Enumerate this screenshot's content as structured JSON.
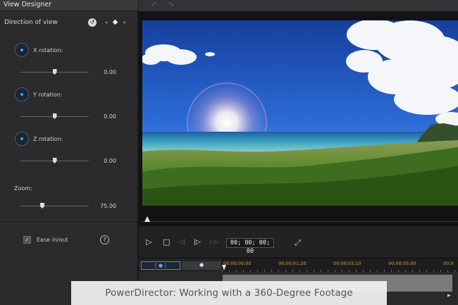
{
  "panel": {
    "title": "View Designer",
    "direction_label": "Direction of view",
    "keyframe_prev": "◂",
    "keyframe_add": "◆",
    "keyframe_next": "▸",
    "keyframe_reset": "↺",
    "x_rotation": {
      "label": "X rotation:",
      "value": "0.00",
      "level": 0.5
    },
    "y_rotation": {
      "label": "Y rotation:",
      "value": "0.00",
      "level": 0.5
    },
    "z_rotation": {
      "label": "Z rotation:",
      "value": "0.00",
      "level": 0.5
    },
    "zoom": {
      "label": "Zoom:",
      "value": "75.00",
      "level": 0.32
    },
    "ease_label": "Ease in/out",
    "ease_checked": "✓",
    "help": "?"
  },
  "toolbar": {
    "undo": "↶",
    "redo": "↷"
  },
  "playback": {
    "play": "▷",
    "stop": "□",
    "prev_frame": "◁|",
    "next_frame": "|▷",
    "fast_forward": "▷▷",
    "timecode": "00; 00; 00; 00",
    "fit": "⤢",
    "expand": "▼"
  },
  "timeline": {
    "tab_a": "[ ● ]",
    "tab_b": "●",
    "ruler_labels": [
      "00;00;00;00",
      "00;00;01;20",
      "00;00;03;10",
      "00;00;05;00",
      "00;0"
    ],
    "track_arrow": "▶"
  },
  "caption": "PowerDirector: Working with a 360-Degree Footage",
  "colors": {
    "accent": "#1c4e82",
    "ruler_text": "#cfa44a",
    "panel_bg": "#2b2b2d"
  }
}
